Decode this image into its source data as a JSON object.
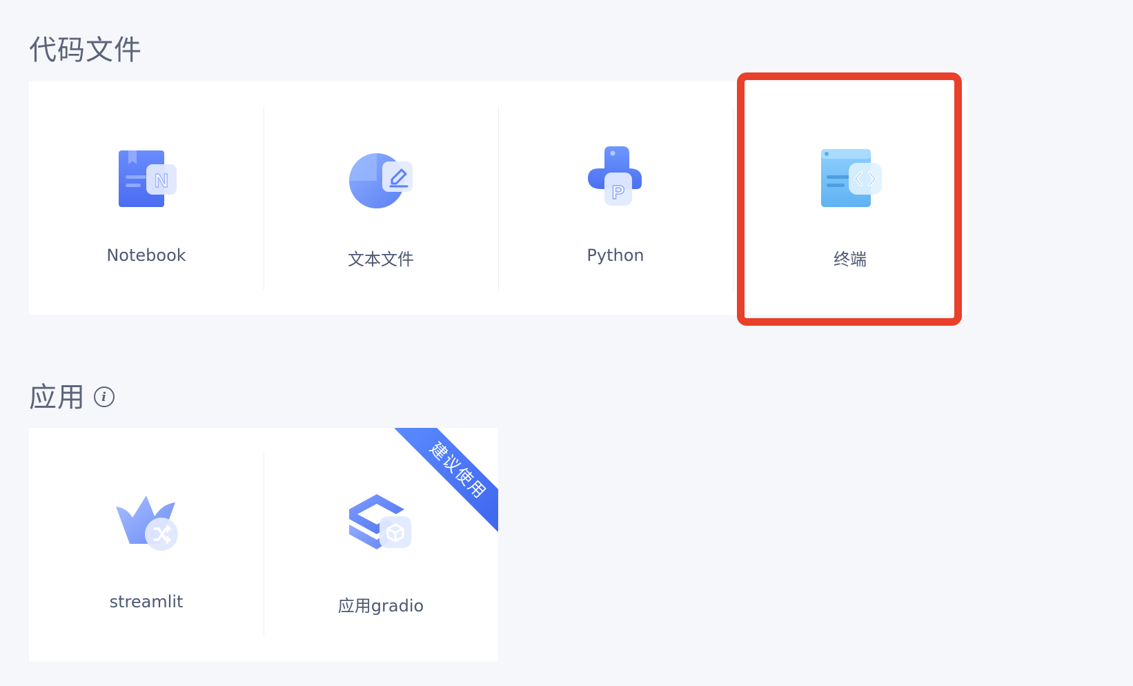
{
  "sections": {
    "code_files": {
      "title": "代码文件"
    },
    "apps": {
      "title": "应用",
      "info_icon": "info-icon"
    }
  },
  "code_cards": [
    {
      "label": "Notebook",
      "icon": "notebook-icon"
    },
    {
      "label": "文本文件",
      "icon": "text-file-icon"
    },
    {
      "label": "Python",
      "icon": "python-icon"
    },
    {
      "label": "终端",
      "icon": "terminal-icon"
    }
  ],
  "app_cards": [
    {
      "label": "streamlit",
      "icon": "streamlit-icon"
    },
    {
      "label": "应用gradio",
      "icon": "gradio-icon",
      "badge": "建议使用"
    }
  ],
  "colors": {
    "highlight": "#e8402a",
    "accent": "#3d63ee",
    "background": "#f6f7fb"
  }
}
